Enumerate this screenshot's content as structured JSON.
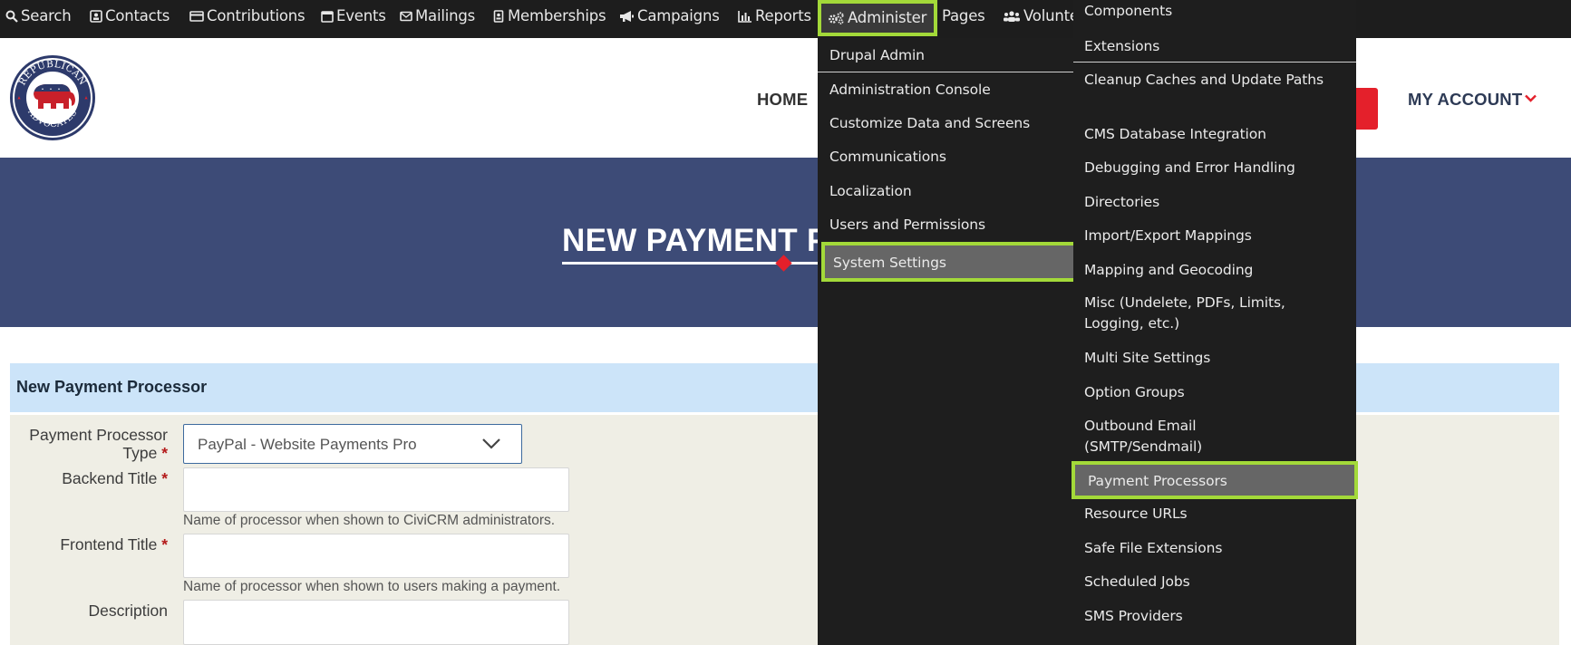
{
  "topbar": {
    "items": [
      {
        "label": "Search",
        "icon": "search-icon"
      },
      {
        "label": "Contacts",
        "icon": "contact-card-icon"
      },
      {
        "label": "Contributions",
        "icon": "credit-card-icon"
      },
      {
        "label": "Events",
        "icon": "calendar-icon"
      },
      {
        "label": "Mailings",
        "icon": "envelope-icon"
      },
      {
        "label": "Memberships",
        "icon": "id-badge-icon"
      },
      {
        "label": "Campaigns",
        "icon": "bullhorn-icon"
      },
      {
        "label": "Reports",
        "icon": "bar-chart-icon"
      },
      {
        "label": "Administer",
        "icon": "gears-icon"
      },
      {
        "label": "Pages",
        "icon": ""
      },
      {
        "label": "Volunte",
        "icon": "users-icon"
      }
    ],
    "highlight_color": "#a3d939"
  },
  "site_header": {
    "logo_text": [
      "REPUBLICAN",
      "ADVOCATES"
    ],
    "nav_home": "HOME",
    "nav_account": "MY ACCOUNT",
    "accent_color": "#e4202b"
  },
  "banner": {
    "title": "NEW PAYMENT P",
    "background": "#3d4b77"
  },
  "form": {
    "section_title": "New Payment Processor",
    "fields": {
      "processor_type": {
        "label_line1": "Payment Processor",
        "label_line2": "Type",
        "value": "PayPal - Website Payments Pro"
      },
      "backend_title": {
        "label": "Backend Title",
        "help": "Name of processor when shown to CiviCRM administrators.",
        "value": ""
      },
      "frontend_title": {
        "label": "Frontend Title",
        "help": "Name of processor when shown to users making a payment.",
        "value": ""
      },
      "description": {
        "label": "Description",
        "value": ""
      }
    },
    "required_marker": "*"
  },
  "administer_menu": {
    "items": [
      "Drupal Admin",
      "Administration Console",
      "Customize Data and Screens",
      "Communications",
      "Localization",
      "Users and Permissions",
      "System Settings"
    ],
    "active": "System Settings"
  },
  "system_settings_menu": {
    "items": [
      "Components",
      "Extensions",
      "Cleanup Caches and Update Paths",
      "CMS Database Integration",
      "Debugging and Error Handling",
      "Directories",
      "Import/Export Mappings",
      "Mapping and Geocoding",
      "Misc (Undelete, PDFs, Limits, Logging, etc.)",
      "Multi Site Settings",
      "Option Groups",
      "Outbound Email (SMTP/Sendmail)",
      "Payment Processors",
      "Resource URLs",
      "Safe File Extensions",
      "Scheduled Jobs",
      "SMS Providers"
    ],
    "active": "Payment Processors"
  }
}
